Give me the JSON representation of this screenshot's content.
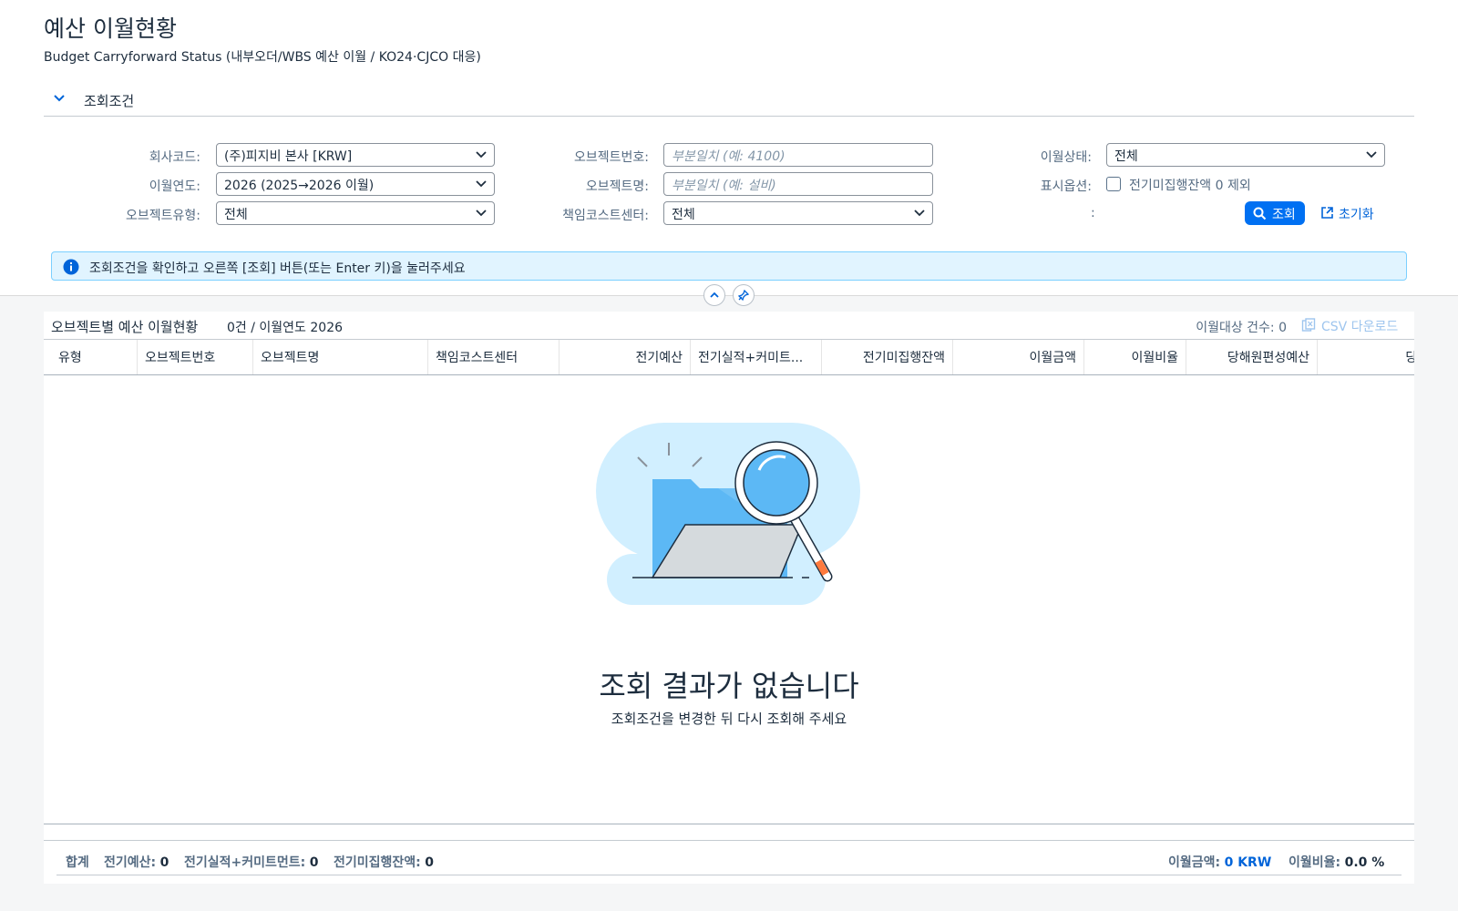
{
  "page": {
    "title": "예산 이월현황",
    "subtitle": "Budget Carryforward Status (내부오더/WBS 예산 이월 / KO24·CJCO 대응)"
  },
  "filter": {
    "header_label": "조회조건",
    "company_label": "회사코드:",
    "company_value": "(주)피지비 본사 [KRW]",
    "year_label": "이월연도:",
    "year_value": "2026 (2025→2026 이월)",
    "objtype_label": "오브젝트유형:",
    "objtype_value": "전체",
    "objno_label": "오브젝트번호:",
    "objno_placeholder": "부분일치 (예: 4100)",
    "objname_label": "오브젝트명:",
    "objname_placeholder": "부분일치 (예: 설비)",
    "costcenter_label": "책임코스트센터:",
    "costcenter_value": "전체",
    "status_label": "이월상태:",
    "status_value": "전체",
    "display_label": "표시옵션:",
    "display_checkbox_label": "전기미집행잔액 0 제외",
    "display_checked": false,
    "colon": ":",
    "search_button": "조회",
    "reset_button": "초기화",
    "info_message": "조회조건을 확인하고 오른쪽 [조회] 버튼(또는 Enter 키)을 눌러주세요"
  },
  "table": {
    "title": "오브젝트별 예산 이월현황",
    "count_text": "0건 / 이월연도 2026",
    "target_count": "이월대상 건수: 0",
    "csv_button": "CSV 다운로드",
    "columns": [
      "유형",
      "오브젝트번호",
      "오브젝트명",
      "책임코스트센터",
      "전기예산",
      "전기실적+커미트...",
      "전기미집행잔액",
      "이월금액",
      "이월비율",
      "당해원편성예산",
      "당해초"
    ],
    "empty_title": "조회 결과가 없습니다",
    "empty_subtitle": "조회조건을 변경한 뒤 다시 조회해 주세요"
  },
  "footer": {
    "total_label": "합계",
    "prev_budget_label": "전기예산:",
    "prev_budget_value": "0",
    "prev_actual_label": "전기실적+커미트먼트:",
    "prev_actual_value": "0",
    "prev_unexec_label": "전기미집행잔액:",
    "prev_unexec_value": "0",
    "carry_amount_label": "이월금액:",
    "carry_amount_value": "0 KRW",
    "carry_ratio_label": "이월비율:",
    "carry_ratio_value": "0.0 %"
  },
  "colors": {
    "accent": "#0070f2",
    "info_bg": "#e1f4ff",
    "info_border": "#7bcfff",
    "link": "#0064d9"
  },
  "icons": {
    "collapse": "chevron-down-icon",
    "info": "info-icon",
    "search": "search-icon",
    "reset": "reset-icon",
    "collapse_header": "chevron-up-icon",
    "pin": "pin-icon",
    "csv": "excel-icon"
  }
}
